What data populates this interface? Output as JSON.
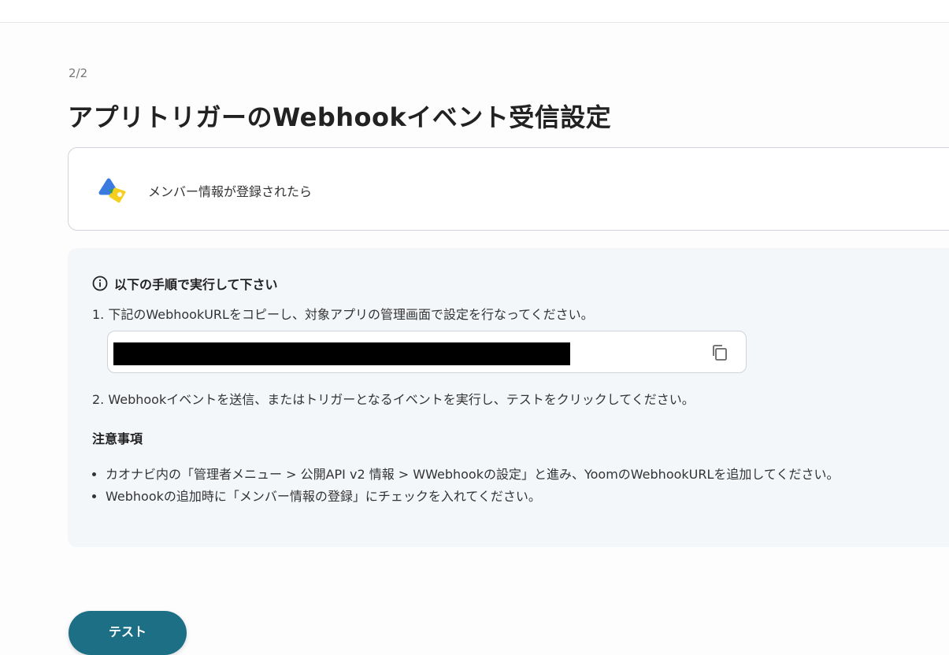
{
  "step_indicator": "2/2",
  "page_title": "アプリトリガーのWebhookイベント受信設定",
  "trigger": {
    "icon": "kaonavi-app-icon",
    "label": "メンバー情報が登録されたら"
  },
  "instructions": {
    "heading_icon": "info-icon",
    "heading": "以下の手順で実行して下さい",
    "step1": "1. 下記のWebhookURLをコピーし、対象アプリの管理画面で設定を行なってください。",
    "url_value": "",
    "copy_icon": "copy-icon",
    "step2": "2. Webhookイベントを送信、またはトリガーとなるイベントを実行し、テストをクリックしてください。",
    "notes_heading": "注意事項",
    "notes": [
      "カオナビ内の「管理者メニュー > 公開API v2 情報 > WWebhookの設定」と進み、YoomのWebhookURLを追加してください。",
      "Webhookの追加時に「メンバー情報の登録」にチェックを入れてください。"
    ]
  },
  "bottom_button": {
    "label": "テスト"
  },
  "colors": {
    "accent": "#1d6f86",
    "panel_bg": "#f4f7fa",
    "border": "#cfd4da"
  }
}
